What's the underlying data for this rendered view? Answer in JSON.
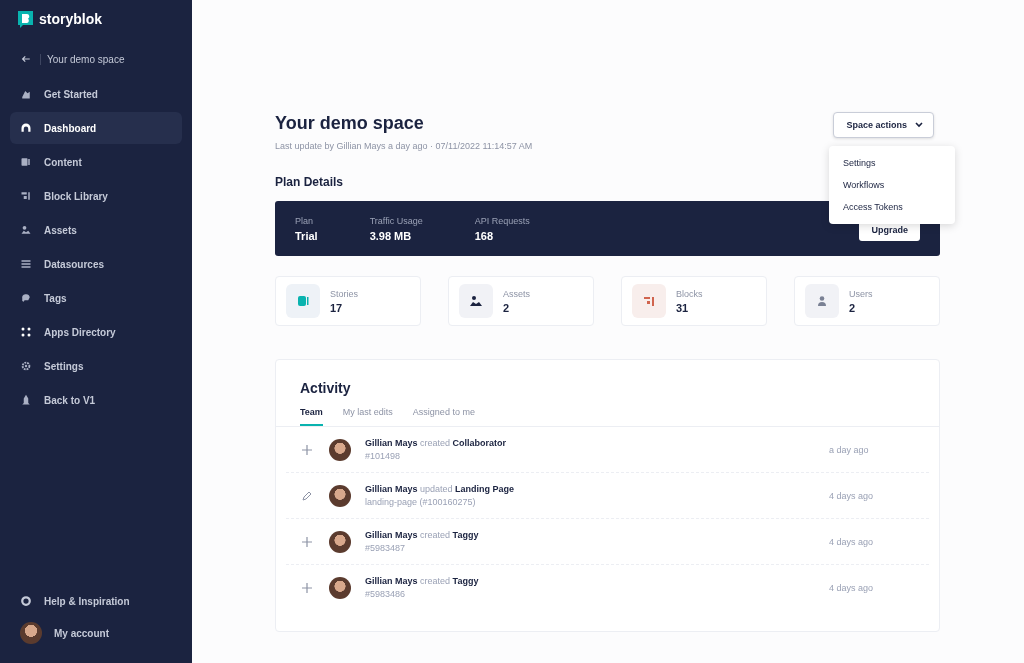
{
  "sidebar": {
    "brand": "storyblok",
    "back_label": "Your demo space",
    "items": [
      {
        "label": "Get Started",
        "selected": false
      },
      {
        "label": "Dashboard",
        "selected": true
      },
      {
        "label": "Content",
        "selected": false
      },
      {
        "label": "Block Library",
        "selected": false
      },
      {
        "label": "Assets",
        "selected": false
      },
      {
        "label": "Datasources",
        "selected": false
      },
      {
        "label": "Tags",
        "selected": false
      },
      {
        "label": "Apps Directory",
        "selected": false
      },
      {
        "label": "Settings",
        "selected": false
      },
      {
        "label": "Back to V1",
        "selected": false
      }
    ],
    "footer": [
      {
        "label": "Help & Inspiration",
        "kind": "help"
      },
      {
        "label": "My account",
        "kind": "account"
      }
    ]
  },
  "header": {
    "title": "Your demo space",
    "subtitle": "Last update by Gillian Mays a day ago · 07/11/2022 11:14:57 AM",
    "space_actions": {
      "label": "Space actions",
      "expanded": true,
      "items": [
        "Settings",
        "Workflows",
        "Access Tokens"
      ]
    }
  },
  "plan": {
    "heading": "Plan Details",
    "fields": [
      {
        "label": "Plan",
        "value": "Trial"
      },
      {
        "label": "Traffic Usage",
        "value": "3.98 MB"
      },
      {
        "label": "API Requests",
        "value": "168"
      }
    ],
    "button": "Upgrade"
  },
  "stats": [
    {
      "label": "Stories",
      "value": "17"
    },
    {
      "label": "Assets",
      "value": "2"
    },
    {
      "label": "Blocks",
      "value": "31"
    },
    {
      "label": "Users",
      "value": "2"
    }
  ],
  "activity": {
    "title": "Activity",
    "tabs": [
      {
        "label": "Team",
        "selected": true
      },
      {
        "label": "My last edits",
        "selected": false
      },
      {
        "label": "Assigned to me",
        "selected": false
      }
    ],
    "rows": [
      {
        "kind": "create",
        "text": "**Gillian Mays** created **Collaborator**",
        "detail": "#101498",
        "time": "a day ago"
      },
      {
        "kind": "update",
        "text": "**Gillian Mays** updated **Landing Page**",
        "detail": "landing-page (#100160275)",
        "time": "4 days ago"
      },
      {
        "kind": "create",
        "text": "**Gillian Mays** created **Taggy**",
        "detail": "#5983487",
        "time": "4 days ago"
      },
      {
        "kind": "create",
        "text": "**Gillian Mays** created **Taggy**",
        "detail": "#5983486",
        "time": "4 days ago"
      }
    ]
  }
}
